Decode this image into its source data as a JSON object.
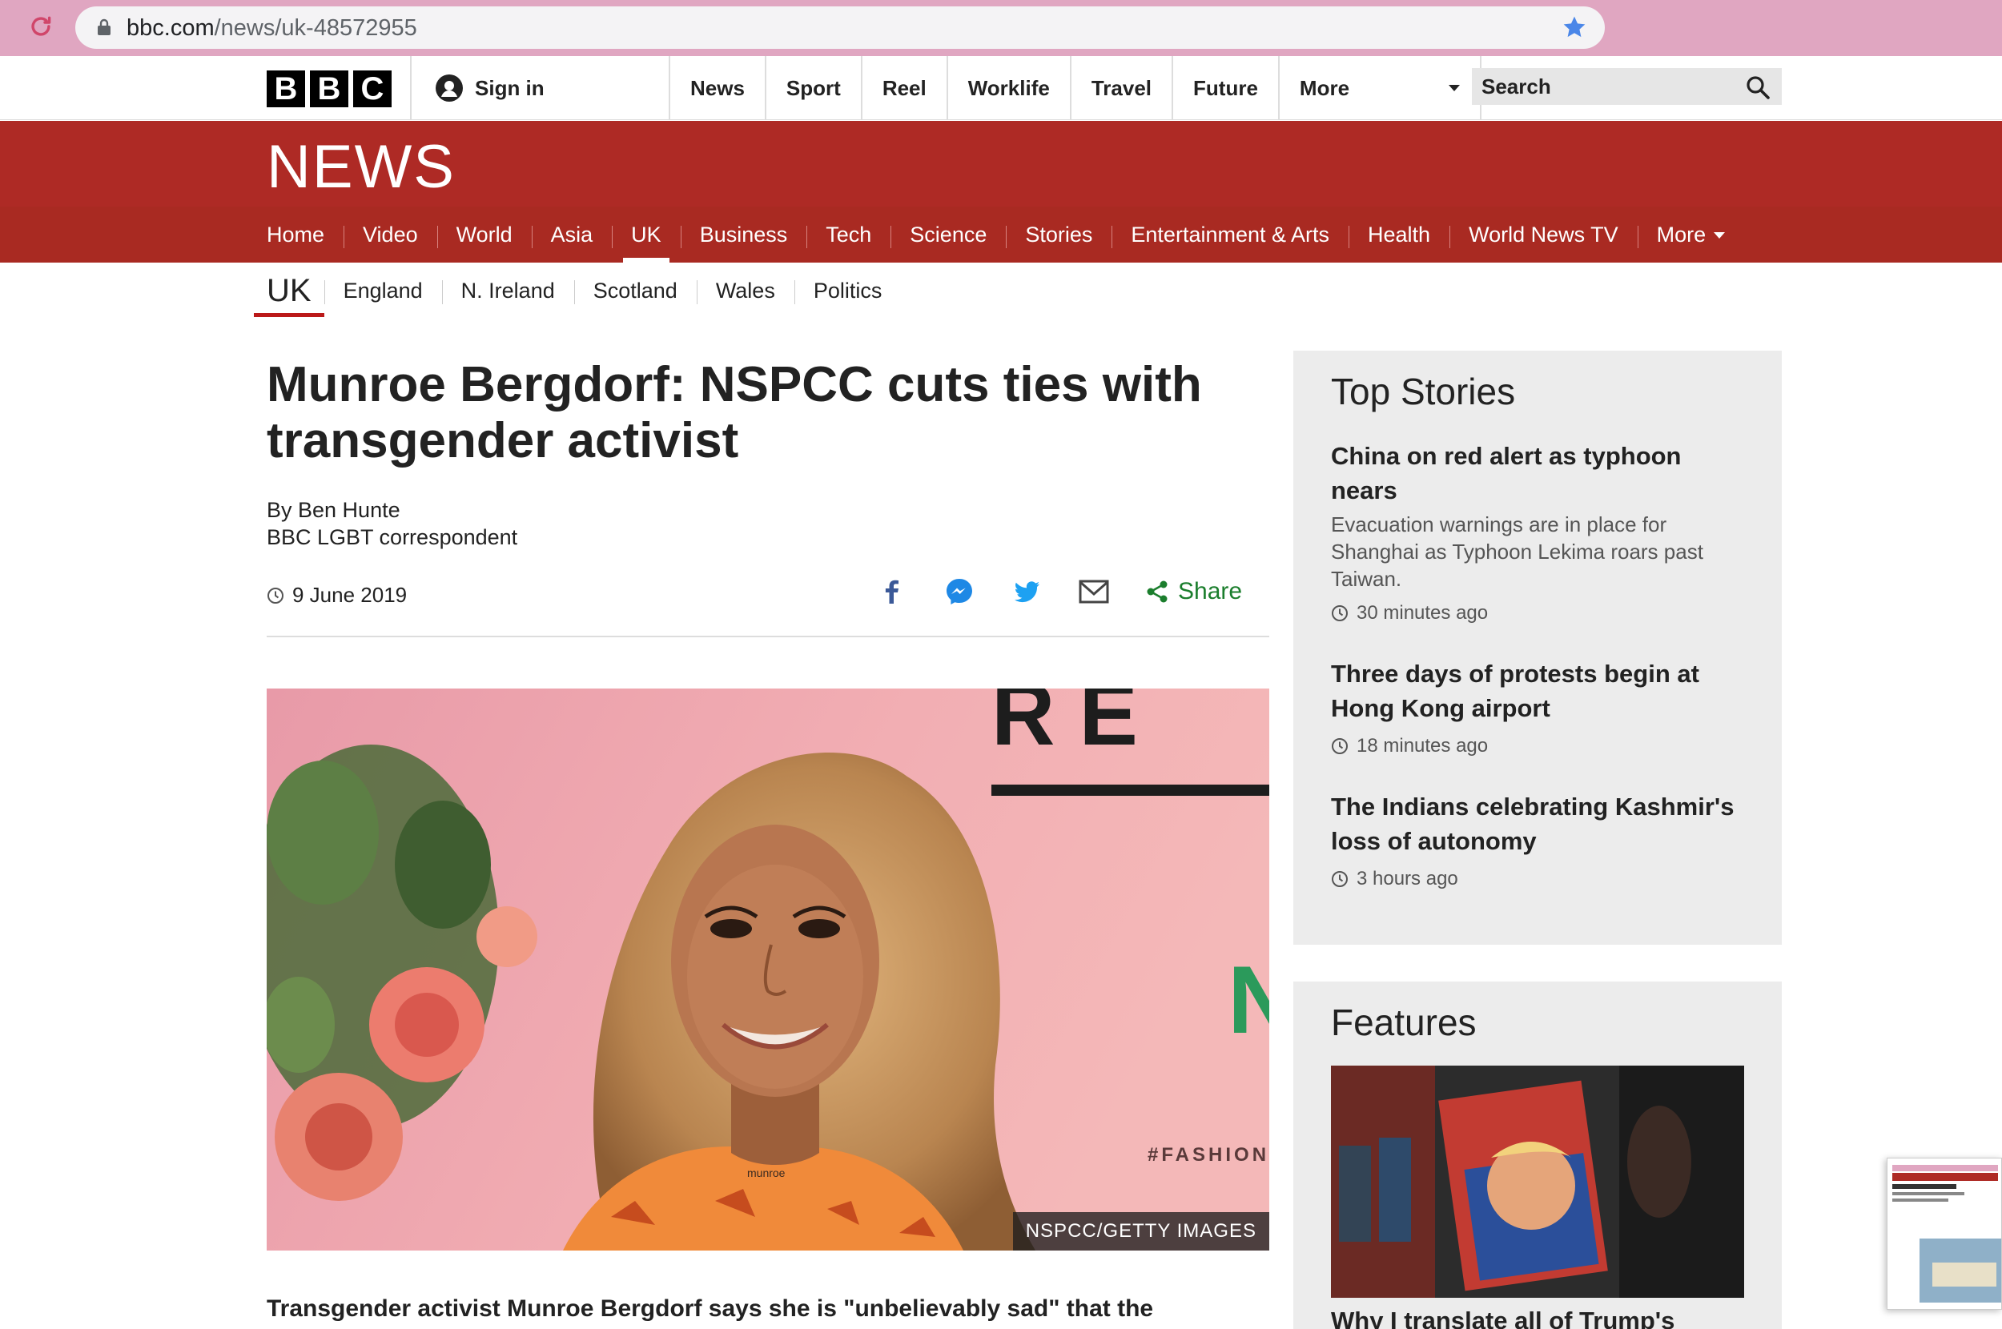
{
  "browser": {
    "url_host": "bbc.com",
    "url_path": "/news/uk-48572955"
  },
  "header": {
    "logo_letters": [
      "B",
      "B",
      "C"
    ],
    "signin_label": "Sign in",
    "nav": [
      "News",
      "Sport",
      "Reel",
      "Worklife",
      "Travel",
      "Future"
    ],
    "more_label": "More",
    "search_placeholder": "Search"
  },
  "news_nav": {
    "brand": "NEWS",
    "items": [
      "Home",
      "Video",
      "World",
      "Asia",
      "UK",
      "Business",
      "Tech",
      "Science",
      "Stories",
      "Entertainment & Arts",
      "Health",
      "World News TV"
    ],
    "active": "UK",
    "more_label": "More"
  },
  "subnav": {
    "section": "UK",
    "items": [
      "England",
      "N. Ireland",
      "Scotland",
      "Wales",
      "Politics"
    ]
  },
  "article": {
    "headline": "Munroe Bergdorf: NSPCC cuts ties with transgender activist",
    "author": "By Ben Hunte",
    "author_role": "BBC LGBT correspondent",
    "date": "9 June 2019",
    "share_label": "Share",
    "image_caption": "NSPCC/GETTY IMAGES",
    "lead": "Transgender activist Munroe Bergdorf says she is \"unbelievably sad\" that the"
  },
  "top_stories": {
    "title": "Top Stories",
    "items": [
      {
        "title": "China on red alert as typhoon nears",
        "summary": "Evacuation warnings are in place for Shanghai as Typhoon Lekima roars past Taiwan.",
        "time": "30 minutes ago"
      },
      {
        "title": "Three days of protests begin at Hong Kong airport",
        "summary": "",
        "time": "18 minutes ago"
      },
      {
        "title": "The Indians celebrating Kashmir's loss of autonomy",
        "summary": "",
        "time": "3 hours ago"
      }
    ]
  },
  "features": {
    "title": "Features",
    "item_title": "Why I translate all of Trump's"
  },
  "colors": {
    "bbc_red": "#ae2a25",
    "share_green": "#1b7e2d",
    "chrome_pink": "#e0a6c1"
  }
}
